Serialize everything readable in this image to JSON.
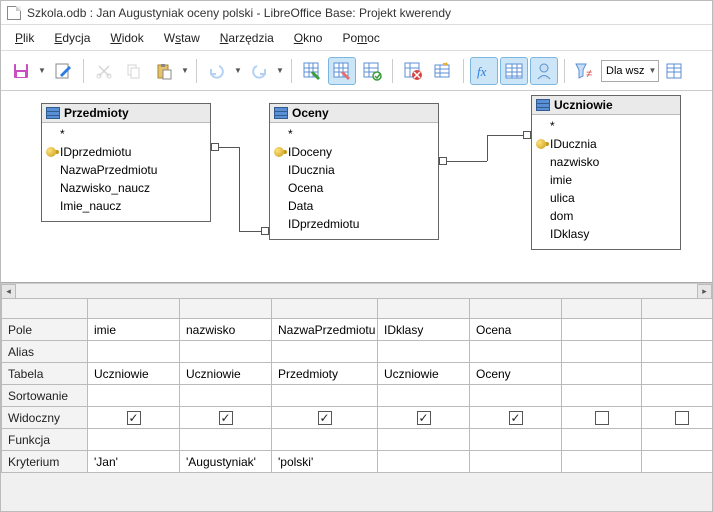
{
  "title": "Szkola.odb : Jan Augustyniak oceny polski - LibreOffice Base: Projekt kwerendy",
  "menu": [
    "Plik",
    "Edycja",
    "Widok",
    "Wstaw",
    "Narzędzia",
    "Okno",
    "Pomoc"
  ],
  "toolbar": {
    "combo_value": "Dla wsz",
    "icons": {
      "save": "save-icon",
      "new": "new-query-icon",
      "cut": "cut-icon",
      "copy": "copy-icon",
      "paste": "paste-icon",
      "undo": "undo-icon",
      "redo": "redo-icon",
      "run": "run-query-icon",
      "run2": "run-autopilot-icon",
      "sql": "sql-view-icon",
      "addtbl": "add-table-icon",
      "newtbl": "new-table-icon",
      "fx": "function-icon",
      "grid": "design-view-icon",
      "alias": "alias-icon",
      "filter": "distinct-values-icon",
      "combo": "limit-combo",
      "props": "properties-icon"
    }
  },
  "tables": [
    {
      "name": "Przedmioty",
      "fields": [
        "*",
        {
          "k": true,
          "n": "IDprzedmiotu"
        },
        "NazwaPrzedmiotu",
        "Nazwisko_naucz",
        "Imie_naucz"
      ]
    },
    {
      "name": "Oceny",
      "fields": [
        "*",
        {
          "k": true,
          "n": "IDoceny"
        },
        "IDucznia",
        "Ocena",
        "Data",
        "IDprzedmiotu"
      ]
    },
    {
      "name": "Uczniowie",
      "fields": [
        "*",
        {
          "k": true,
          "n": "IDucznia"
        },
        "nazwisko",
        "imie",
        "ulica",
        "dom",
        "IDklasy"
      ]
    }
  ],
  "grid": {
    "row_labels": [
      "Pole",
      "Alias",
      "Tabela",
      "Sortowanie",
      "Widoczny",
      "Funkcja",
      "Kryterium"
    ],
    "cols": [
      {
        "pole": "imie",
        "alias": "",
        "tabela": "Uczniowie",
        "sort": "",
        "widoczny": true,
        "funkcja": "",
        "kryt": "'Jan'"
      },
      {
        "pole": "nazwisko",
        "alias": "",
        "tabela": "Uczniowie",
        "sort": "",
        "widoczny": true,
        "funkcja": "",
        "kryt": "'Augustyniak'"
      },
      {
        "pole": "NazwaPrzedmiotu",
        "alias": "",
        "tabela": "Przedmioty",
        "sort": "",
        "widoczny": true,
        "funkcja": "",
        "kryt": "'polski'"
      },
      {
        "pole": "IDklasy",
        "alias": "",
        "tabela": "Uczniowie",
        "sort": "",
        "widoczny": true,
        "funkcja": "",
        "kryt": ""
      },
      {
        "pole": "Ocena",
        "alias": "",
        "tabela": "Oceny",
        "sort": "",
        "widoczny": true,
        "funkcja": "",
        "kryt": ""
      },
      {
        "pole": "",
        "alias": "",
        "tabela": "",
        "sort": "",
        "widoczny": false,
        "funkcja": "",
        "kryt": ""
      },
      {
        "pole": "",
        "alias": "",
        "tabela": "",
        "sort": "",
        "widoczny": false,
        "funkcja": "",
        "kryt": ""
      }
    ]
  }
}
